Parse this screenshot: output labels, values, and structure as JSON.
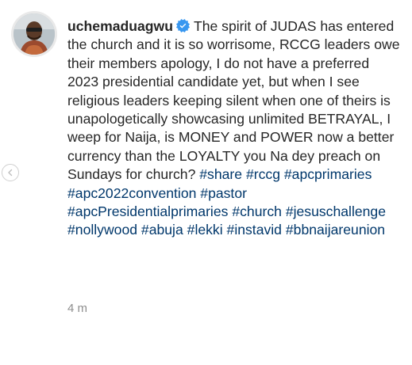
{
  "post": {
    "username": "uchemaduagwu",
    "verified": true,
    "caption_text": "The spirit of JUDAS has entered the church and it is so worrisome, RCCG leaders owe their members apology, I do not have a preferred 2023 presidential candidate yet, but when I see religious leaders keeping silent when one of theirs is unapologetically showcasing unlimited BETRAYAL, I weep for Naija, is MONEY and POWER now a better currency than the LOYALTY you Na dey preach on Sundays for church?",
    "hashtags": [
      "#share",
      "#rccg",
      "#apcprimaries",
      "#apc2022convention",
      "#pastor",
      "#apcPresidentialprimaries",
      "#church",
      "#jesuschallenge",
      "#nollywood",
      "#abuja",
      "#lekki",
      "#instavid",
      "#bbnaijareunion"
    ],
    "timestamp": "4 m"
  },
  "colors": {
    "text": "#262626",
    "hashtag": "#00376b",
    "muted": "#8e8e8e",
    "verified_badge": "#3897f0"
  },
  "icons": {
    "verified": "verified-badge-icon",
    "carousel_prev": "chevron-left-icon"
  }
}
